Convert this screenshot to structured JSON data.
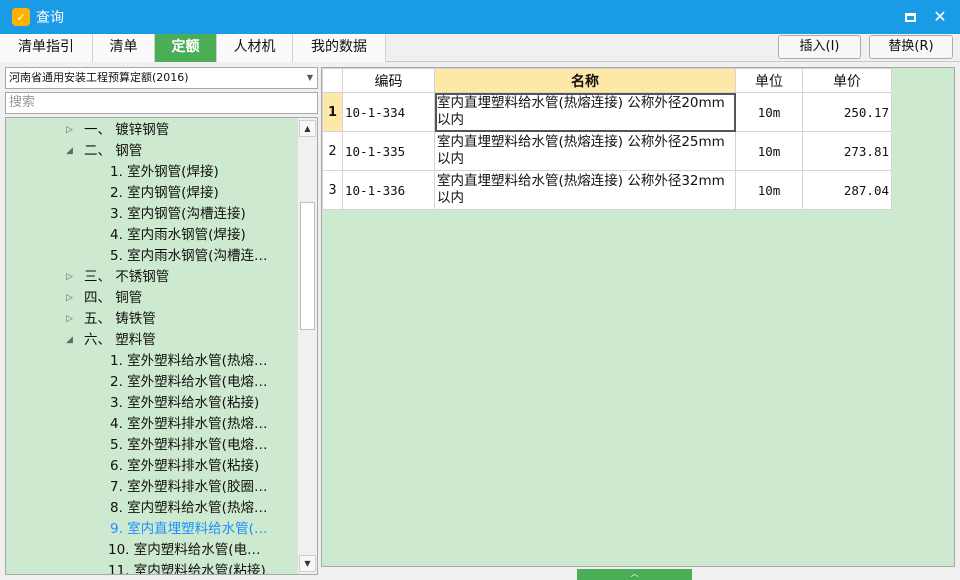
{
  "window": {
    "title": "查询",
    "app_icon": "app-logo-icon"
  },
  "tabs": [
    "清单指引",
    "清单",
    "定额",
    "人材机",
    "我的数据"
  ],
  "active_tab": "定额",
  "toolbar": {
    "insert_label": "插入(I)",
    "replace_label": "替换(R)"
  },
  "left": {
    "quota_library": "河南省通用安装工程预算定额(2016)",
    "search_placeholder": "搜索",
    "tree": [
      {
        "text": "一、  镀锌钢管",
        "expander": "▷"
      },
      {
        "text": "二、  钢管",
        "expander": "◢"
      },
      {
        "text": "1.  室外钢管(焊接)"
      },
      {
        "text": "2.  室内钢管(焊接)"
      },
      {
        "text": "3.  室内钢管(沟槽连接)"
      },
      {
        "text": "4.  室内雨水钢管(焊接)"
      },
      {
        "text": "5.  室内雨水钢管(沟槽连…"
      },
      {
        "text": "三、  不锈钢管",
        "expander": "▷"
      },
      {
        "text": "四、  铜管",
        "expander": "▷"
      },
      {
        "text": "五、  铸铁管",
        "expander": "▷"
      },
      {
        "text": "六、  塑料管",
        "expander": "◢"
      },
      {
        "text": "1.  室外塑料给水管(热熔…"
      },
      {
        "text": "2.  室外塑料给水管(电熔…"
      },
      {
        "text": "3.  室外塑料给水管(粘接)"
      },
      {
        "text": "4.  室外塑料排水管(热熔…"
      },
      {
        "text": "5.  室外塑料排水管(电熔…"
      },
      {
        "text": "6.  室外塑料排水管(粘接)"
      },
      {
        "text": "7.  室外塑料排水管(胶圈…"
      },
      {
        "text": "8.  室内塑料给水管(热熔…"
      },
      {
        "text": "9.  室内直埋塑料给水管(…",
        "selected": true
      },
      {
        "text": "10.  室内塑料给水管(电…"
      },
      {
        "text": "11.  室内塑料给水管(粘接)"
      }
    ]
  },
  "grid": {
    "headers": {
      "code": "编码",
      "name": "名称",
      "unit": "单位",
      "price": "单价"
    },
    "rows": [
      {
        "idx": "1",
        "code": "10-1-334",
        "name": "室内直埋塑料给水管(热熔连接) 公称外径20mm以内",
        "unit": "10m",
        "price": "250.17",
        "selected": true
      },
      {
        "idx": "2",
        "code": "10-1-335",
        "name": "室内直埋塑料给水管(热熔连接) 公称外径25mm以内",
        "unit": "10m",
        "price": "273.81"
      },
      {
        "idx": "3",
        "code": "10-1-336",
        "name": "室内直埋塑料给水管(热熔连接) 公称外径32mm以内",
        "unit": "10m",
        "price": "287.04"
      }
    ]
  },
  "colors": {
    "titlebar": "#1a9be6",
    "active_tab": "#4aae56",
    "pane_bg": "#cde9cf",
    "header_highlight": "#fde8a8",
    "selected_tree_text": "#1e90ff"
  }
}
